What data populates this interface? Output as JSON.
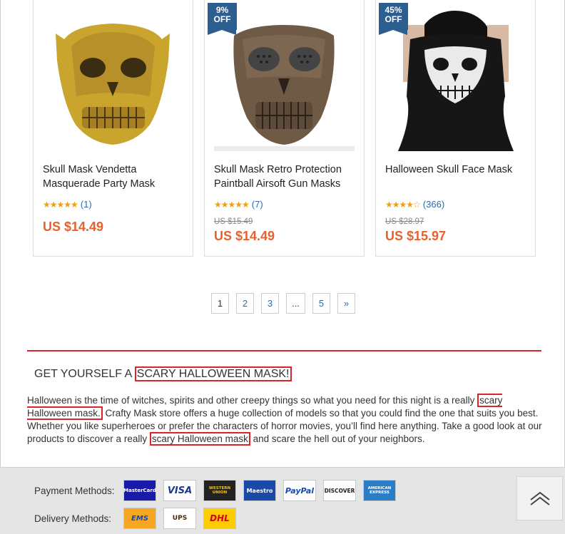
{
  "products": [
    {
      "name": "Skull Mask Vendetta Masquerade Party Mask",
      "stars": "★★★★★",
      "rating_count": "(1)",
      "old_price": "",
      "price": "US $14.49",
      "badge_pct": "",
      "badge_off": "",
      "image": "gold-skull-mask-image"
    },
    {
      "name": "Skull Mask Retro Protection Paintball Airsoft Gun Masks",
      "stars": "★★★★★",
      "rating_count": "(7)",
      "old_price": "US $15.49",
      "price": "US $14.49",
      "badge_pct": "9%",
      "badge_off": "OFF",
      "image": "bronze-skull-mask-image"
    },
    {
      "name": "Halloween Skull Face Mask",
      "stars": "★★★★☆",
      "rating_count": "(366)",
      "old_price": "US $28.97",
      "price": "US $15.97",
      "badge_pct": "45%",
      "badge_off": "OFF",
      "image": "skull-face-bandana-image"
    }
  ],
  "pagination": {
    "pages": [
      "1",
      "2",
      "3",
      "...",
      "5",
      "»"
    ],
    "current": "1"
  },
  "seo": {
    "title_prefix": "GET YOURSELF A ",
    "title_highlight": "SCARY HALLOWEEN MASK!",
    "p1": "Halloween is the time of witches, spirits and other creepy things so what you need for this night is a really ",
    "hl1": "scary Halloween mask.",
    "p2": " Crafty Mask store offers a huge collection of models so that you could find the one that suits you best. Whether you like superheroes or prefer the characters of horror movies, you’ll find here anything. Take a good look at our products to discover a really ",
    "hl2": "scary Halloween mask",
    "p3": " and scare the hell out of your neighbors."
  },
  "footer": {
    "payment_label": "Payment Methods:",
    "payment_logos": [
      "MasterCard",
      "VISA",
      "WESTERN UNION",
      "Maestro",
      "PayPal",
      "DISCOVER",
      "AMERICAN EXPRESS"
    ],
    "delivery_label": "Delivery Methods:",
    "delivery_logos": [
      "EMS",
      "UPS",
      "DHL"
    ]
  },
  "colors": {
    "accent_red": "#d9242b",
    "price_orange": "#e8612c",
    "badge_blue": "#2c5e8f",
    "link_blue": "#2a6bb5"
  }
}
